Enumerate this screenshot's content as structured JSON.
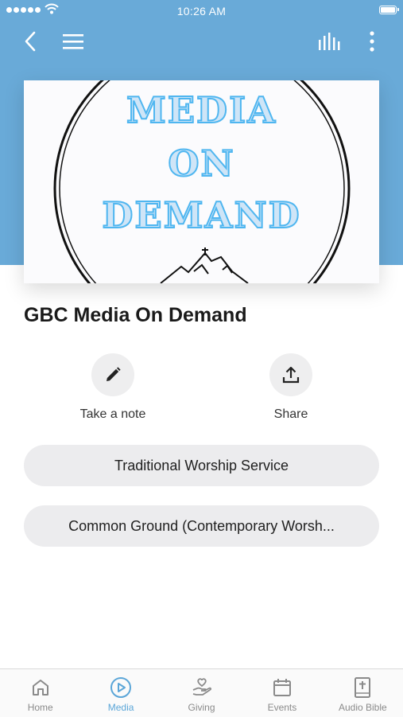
{
  "status_bar": {
    "time": "10:26 AM"
  },
  "header": {
    "back_icon": "chevron-left-icon",
    "menu_icon": "hamburger-menu-icon",
    "audio_icon": "audio-bars-icon",
    "more_icon": "more-vertical-icon",
    "background_color": "#69aad8"
  },
  "artwork": {
    "line1": "MEDIA",
    "line2": "ON",
    "line3": "DEMAND"
  },
  "page_title": "GBC Media On Demand",
  "actions": [
    {
      "label": "Take a note",
      "icon": "pencil-icon"
    },
    {
      "label": "Share",
      "icon": "share-upload-icon"
    }
  ],
  "items": [
    {
      "label": "Traditional Worship Service"
    },
    {
      "label": "Common Ground (Contemporary Worsh..."
    }
  ],
  "tabbar": {
    "active_color": "#5ba6d8",
    "tabs": [
      {
        "label": "Home",
        "icon": "home-icon",
        "active": false
      },
      {
        "label": "Media",
        "icon": "play-circle-icon",
        "active": true
      },
      {
        "label": "Giving",
        "icon": "giving-hand-heart-icon",
        "active": false
      },
      {
        "label": "Events",
        "icon": "calendar-icon",
        "active": false
      },
      {
        "label": "Audio Bible",
        "icon": "bible-icon",
        "active": false
      }
    ]
  }
}
